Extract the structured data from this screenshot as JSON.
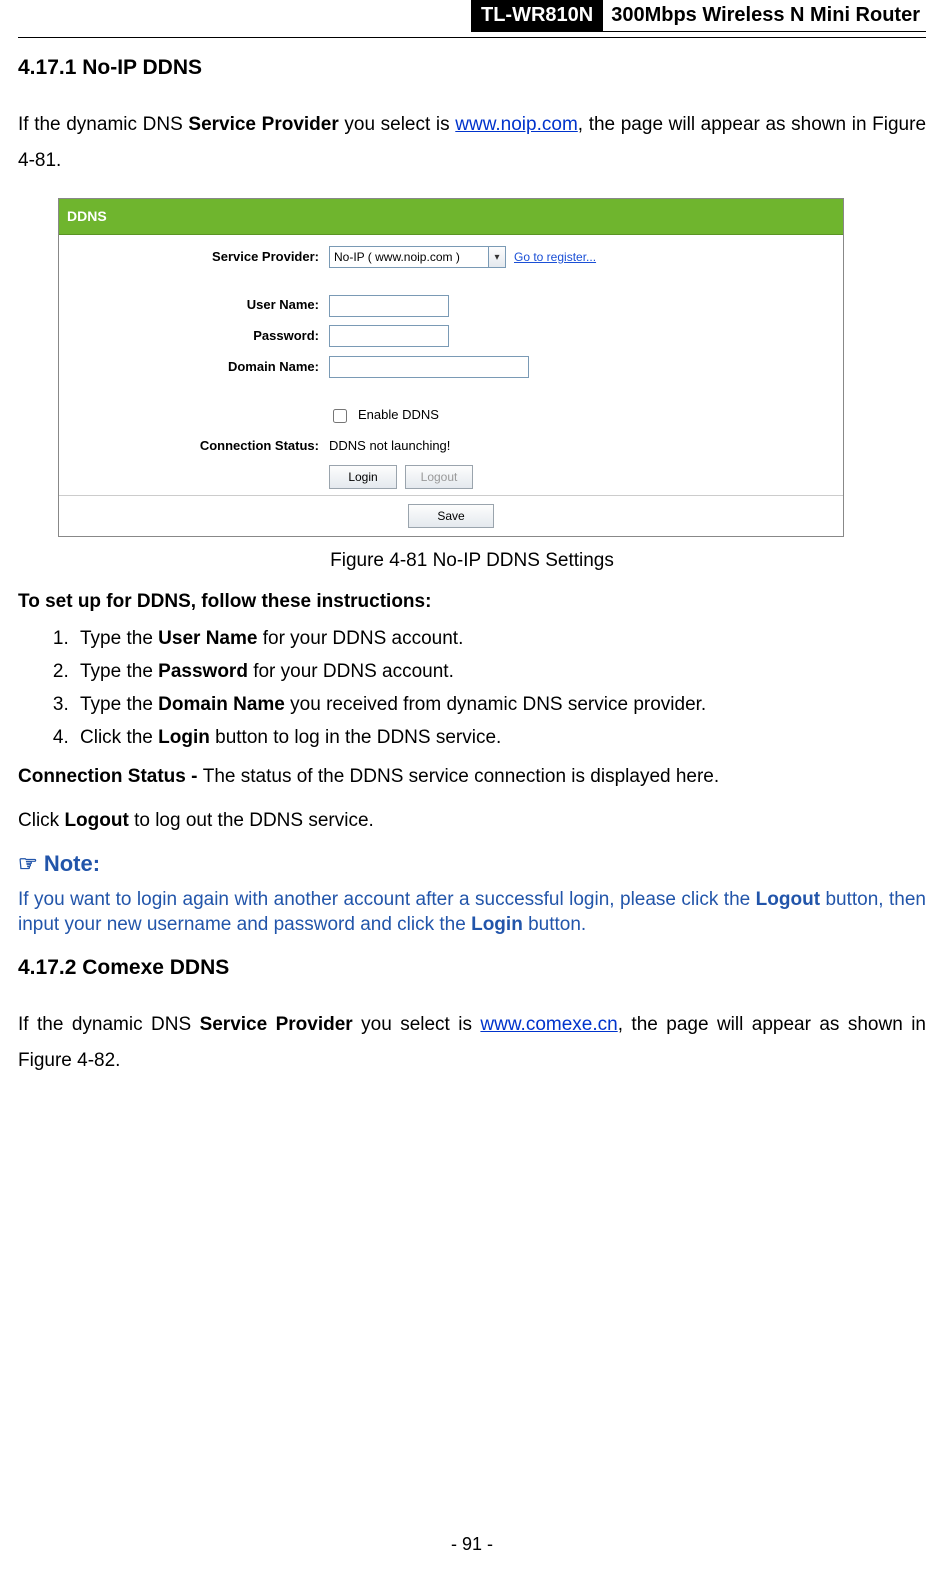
{
  "header": {
    "model": "TL-WR810N",
    "desc": "300Mbps Wireless N Mini Router"
  },
  "s1": {
    "heading": "4.17.1 No-IP DDNS",
    "intro_a": "If the dynamic DNS ",
    "intro_b": "Service Provider",
    "intro_c": " you select is ",
    "intro_link": "www.noip.com",
    "intro_d": ", the page will appear as shown in Figure 4-81."
  },
  "shot": {
    "title": "DDNS",
    "labels": {
      "service_provider": "Service Provider:",
      "user_name": "User Name:",
      "password": "Password:",
      "domain_name": "Domain Name:",
      "connection_status": "Connection Status:"
    },
    "service_provider_value": "No-IP ( www.noip.com )",
    "register_link": "Go to register...",
    "enable_ddns": "Enable DDNS",
    "status_text": "DDNS not launching!",
    "login_btn": "Login",
    "logout_btn": "Logout",
    "save_btn": "Save"
  },
  "fig_caption": "Figure 4-81 No-IP DDNS Settings",
  "instr_head": "To set up for DDNS, follow these instructions:",
  "instr": [
    {
      "pre": "Type the ",
      "b": "User Name",
      "post": " for your DDNS account."
    },
    {
      "pre": "Type the ",
      "b": "Password",
      "post": " for your DDNS account."
    },
    {
      "pre": "Type the ",
      "b": "Domain Name",
      "post": " you received from dynamic DNS service provider."
    },
    {
      "pre": "Click the ",
      "b": "Login",
      "post": " button to log in the DDNS service."
    }
  ],
  "conn_status_a": "Connection Status - ",
  "conn_status_b": "The status of the DDNS service connection is displayed here.",
  "logout_a": "Click ",
  "logout_b": "Logout",
  "logout_c": " to log out the DDNS service.",
  "note": {
    "icon": "☞",
    "head": " Note:",
    "body_a": "If you want to login again with another account after a successful login, please click the ",
    "body_b": "Logout",
    "body_c": " button, then input your new username and password and click the ",
    "body_d": "Login",
    "body_e": " button."
  },
  "s2": {
    "heading": "4.17.2 Comexe DDNS",
    "intro_a": "If the dynamic DNS ",
    "intro_b": "Service Provider",
    "intro_c": " you select is ",
    "intro_link": "www.comexe.cn",
    "intro_d": ", the page will appear as shown in Figure 4-82."
  },
  "page_num": "- 91 -"
}
